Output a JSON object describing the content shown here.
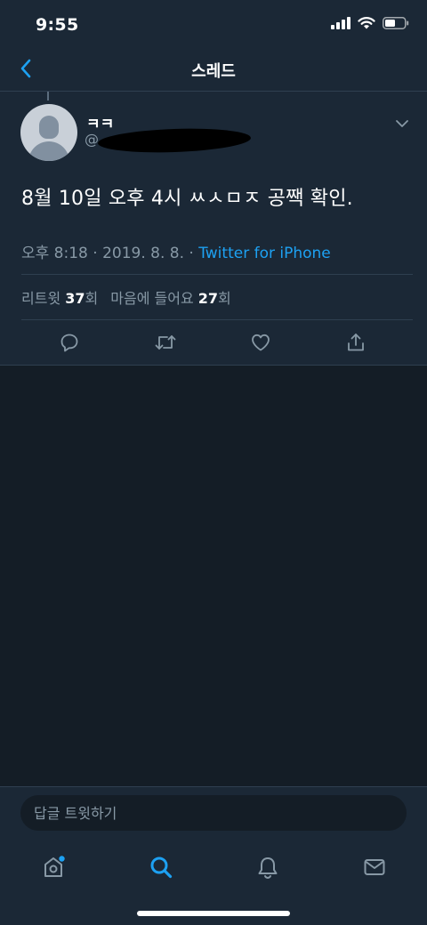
{
  "status_bar": {
    "time": "9:55"
  },
  "nav": {
    "title": "스레드"
  },
  "tweet": {
    "display_name": "ㅋㅋ",
    "handle": "@",
    "text": "8월 10일 오후 4시 ㅆㅅㅁㅈ 공짹 확인.",
    "timestamp": "오후 8:18 · 2019. 8. 8. · ",
    "source": "Twitter for iPhone",
    "stats": {
      "retweets_label": "리트윗",
      "retweets_count": "37",
      "retweets_unit": "회",
      "likes_label": "마음에 들어요",
      "likes_count": "27",
      "likes_unit": "회"
    }
  },
  "reply": {
    "placeholder": "답글 트윗하기"
  },
  "colors": {
    "accent": "#1da1f2",
    "background": "#141d26",
    "surface": "#1b2836",
    "muted": "#8899a6"
  }
}
